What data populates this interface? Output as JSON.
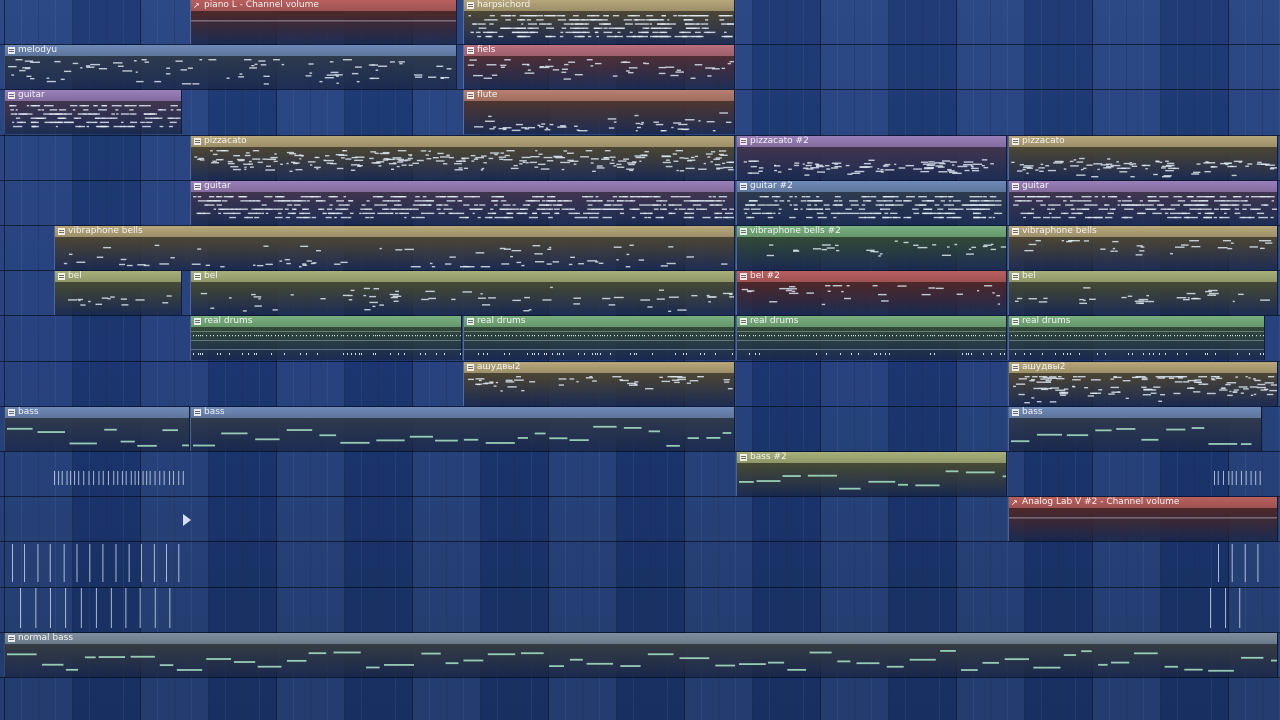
{
  "playlist": {
    "clips": [
      {
        "name": "piano L - Channel volume",
        "kind": "automation",
        "color": "#b9605f",
        "lane": 0,
        "start": 190,
        "end": 457,
        "density": 0,
        "seed": 11
      },
      {
        "name": "harpsichord",
        "kind": "pattern",
        "color": "#b7a77a",
        "lane": 0,
        "start": 463,
        "end": 735,
        "density": 2.8,
        "seed": 12
      },
      {
        "name": "melodyu",
        "kind": "pattern",
        "color": "#6f8ab8",
        "lane": 1,
        "start": 4,
        "end": 457,
        "density": 0.55,
        "seed": 13
      },
      {
        "name": "fiels",
        "kind": "pattern",
        "color": "#b9707d",
        "lane": 1,
        "start": 463,
        "end": 735,
        "density": 0.55,
        "seed": 14
      },
      {
        "name": "guitar",
        "kind": "pattern",
        "color": "#9a7fb9",
        "lane": 2,
        "start": 4,
        "end": 182,
        "density": 2.2,
        "seed": 15
      },
      {
        "name": "flute",
        "kind": "pattern",
        "color": "#b98070",
        "lane": 2,
        "start": 463,
        "end": 735,
        "density": 0.55,
        "seed": 16
      },
      {
        "name": "pizzacato",
        "kind": "pattern",
        "color": "#b7a77a",
        "lane": 3,
        "start": 190,
        "end": 735,
        "density": 1.3,
        "seed": 17
      },
      {
        "name": "pizzacato #2",
        "kind": "pattern",
        "color": "#9a7fb9",
        "lane": 3,
        "start": 736,
        "end": 1007,
        "density": 1.0,
        "seed": 18
      },
      {
        "name": "pizzacato",
        "kind": "pattern",
        "color": "#b7a77a",
        "lane": 3,
        "start": 1008,
        "end": 1278,
        "density": 1.0,
        "seed": 19
      },
      {
        "name": "guitar",
        "kind": "pattern",
        "color": "#9a7fb9",
        "lane": 4,
        "start": 190,
        "end": 735,
        "density": 2.2,
        "seed": 20
      },
      {
        "name": "guitar #2",
        "kind": "pattern",
        "color": "#6f8ab8",
        "lane": 4,
        "start": 736,
        "end": 1007,
        "density": 2.2,
        "seed": 21
      },
      {
        "name": "guitar",
        "kind": "pattern",
        "color": "#9a7fb9",
        "lane": 4,
        "start": 1008,
        "end": 1278,
        "density": 2.2,
        "seed": 22
      },
      {
        "name": "vibraphone bells",
        "kind": "pattern",
        "color": "#b7a77a",
        "lane": 5,
        "start": 54,
        "end": 735,
        "density": 0.35,
        "seed": 23
      },
      {
        "name": "vibraphone bells #2",
        "kind": "pattern",
        "color": "#78b07f",
        "lane": 5,
        "start": 736,
        "end": 1007,
        "density": 0.35,
        "seed": 24
      },
      {
        "name": "vibraphone bells",
        "kind": "pattern",
        "color": "#b7a77a",
        "lane": 5,
        "start": 1008,
        "end": 1278,
        "density": 0.35,
        "seed": 25
      },
      {
        "name": "bel",
        "kind": "pattern",
        "color": "#a7b07a",
        "lane": 6,
        "start": 54,
        "end": 182,
        "density": 0.35,
        "seed": 26
      },
      {
        "name": "bel",
        "kind": "pattern",
        "color": "#a7b07a",
        "lane": 6,
        "start": 190,
        "end": 735,
        "density": 0.35,
        "seed": 27
      },
      {
        "name": "bel #2",
        "kind": "pattern",
        "color": "#b9605f",
        "lane": 6,
        "start": 736,
        "end": 1007,
        "density": 0.35,
        "seed": 28
      },
      {
        "name": "bel",
        "kind": "pattern",
        "color": "#a7b07a",
        "lane": 6,
        "start": 1008,
        "end": 1278,
        "density": 0.35,
        "seed": 29
      },
      {
        "name": "real drums",
        "kind": "drums",
        "color": "#78b07f",
        "lane": 7,
        "start": 190,
        "end": 462,
        "density": 0,
        "seed": 30
      },
      {
        "name": "real drums",
        "kind": "drums",
        "color": "#78b07f",
        "lane": 7,
        "start": 463,
        "end": 735,
        "density": 0,
        "seed": 31
      },
      {
        "name": "real drums",
        "kind": "drums",
        "color": "#78b07f",
        "lane": 7,
        "start": 736,
        "end": 1007,
        "density": 0,
        "seed": 32
      },
      {
        "name": "real drums",
        "kind": "drums",
        "color": "#78b07f",
        "lane": 7,
        "start": 1008,
        "end": 1265,
        "density": 0,
        "seed": 33
      },
      {
        "name": "ашудвы2",
        "kind": "pattern",
        "color": "#b7a77a",
        "lane": 8,
        "start": 463,
        "end": 735,
        "density": 0.55,
        "seed": 34
      },
      {
        "name": "ашудвы2",
        "kind": "pattern",
        "color": "#b7a77a",
        "lane": 8,
        "start": 1008,
        "end": 1278,
        "density": 1.4,
        "seed": 35
      },
      {
        "name": "bass",
        "kind": "bass",
        "color": "#6f8ab8",
        "lane": 9,
        "start": 4,
        "end": 190,
        "density": 0,
        "seed": 36
      },
      {
        "name": "bass",
        "kind": "bass",
        "color": "#6f8ab8",
        "lane": 9,
        "start": 190,
        "end": 735,
        "density": 0,
        "seed": 37
      },
      {
        "name": "bass",
        "kind": "bass",
        "color": "#6f8ab8",
        "lane": 9,
        "start": 1008,
        "end": 1262,
        "density": 0,
        "seed": 38
      },
      {
        "name": "bass #2",
        "kind": "bass",
        "color": "#a7b07a",
        "lane": 10,
        "start": 736,
        "end": 1007,
        "density": 0,
        "seed": 39
      },
      {
        "name": "Analog Lab V #2 - Channel volume",
        "kind": "automation",
        "color": "#b9605f",
        "lane": 11,
        "start": 1008,
        "end": 1278,
        "density": 0,
        "seed": 40
      },
      {
        "name": "normal bass",
        "kind": "bass",
        "color": "#7f8f9f",
        "lane": 14,
        "start": 4,
        "end": 1278,
        "density": 0,
        "seed": 41
      }
    ]
  }
}
